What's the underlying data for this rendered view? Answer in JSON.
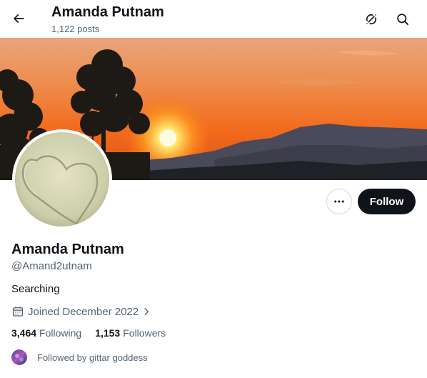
{
  "header": {
    "title": "Amanda Putnam",
    "posts": "1,122 posts",
    "back_icon": "arrow-left-icon",
    "grok_icon": "grok-off-icon",
    "search_icon": "search-icon"
  },
  "profile": {
    "display_name": "Amanda Putnam",
    "handle": "@Amand2utnam",
    "bio": "Searching",
    "joined": "Joined December 2022",
    "following_count": "3,464",
    "following_label": "Following",
    "followers_count": "1,153",
    "followers_label": "Followers",
    "followed_by": "Followed by gittar goddess"
  },
  "actions": {
    "more_icon": "more-dots-icon",
    "follow_label": "Follow"
  },
  "colors": {
    "text_primary": "#0f1419",
    "text_secondary": "#536471",
    "follow_bg": "#0f1419",
    "border": "#cfd9de"
  }
}
